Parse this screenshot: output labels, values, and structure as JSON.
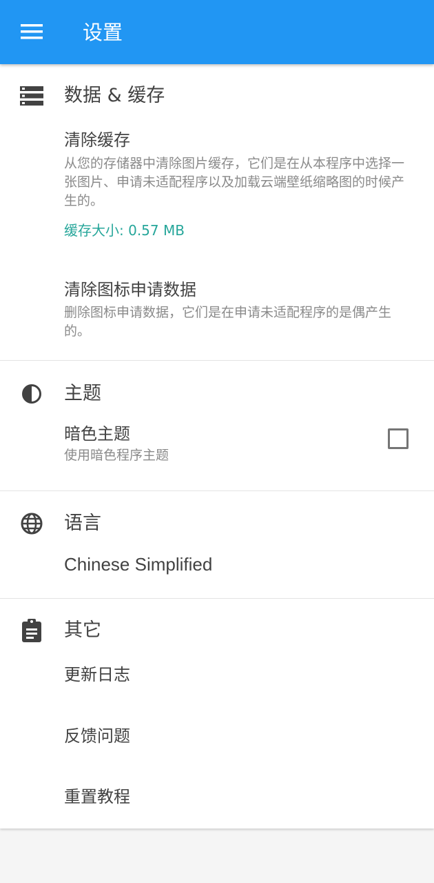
{
  "appbar": {
    "title": "设置",
    "menu_icon": "menu-icon",
    "color": "#2196F3"
  },
  "sections": {
    "data": {
      "title": "数据 & 缓存",
      "icon": "storage-icon",
      "clear_cache": {
        "title": "清除缓存",
        "subtitle": "从您的存储器中清除图片缓存，它们是在从本程序中选择一张图片、申请未适配程序以及加载云端壁纸缩略图的时候产生的。",
        "cache_size": "缓存大小: 0.57 MB"
      },
      "clear_icon_request": {
        "title": "清除图标申请数据",
        "subtitle": "删除图标申请数据，它们是在申请未适配程序的是偶产生的。"
      }
    },
    "theme": {
      "title": "主题",
      "icon": "contrast-icon",
      "dark_theme": {
        "title": "暗色主题",
        "subtitle": "使用暗色程序主题",
        "checked": false
      }
    },
    "language": {
      "title": "语言",
      "icon": "globe-icon",
      "current": "Chinese Simplified"
    },
    "other": {
      "title": "其它",
      "icon": "clipboard-icon",
      "items": [
        "更新日志",
        "反馈问题",
        "重置教程"
      ]
    }
  },
  "colors": {
    "accent": "#26a69a",
    "primary": "#2196F3"
  }
}
